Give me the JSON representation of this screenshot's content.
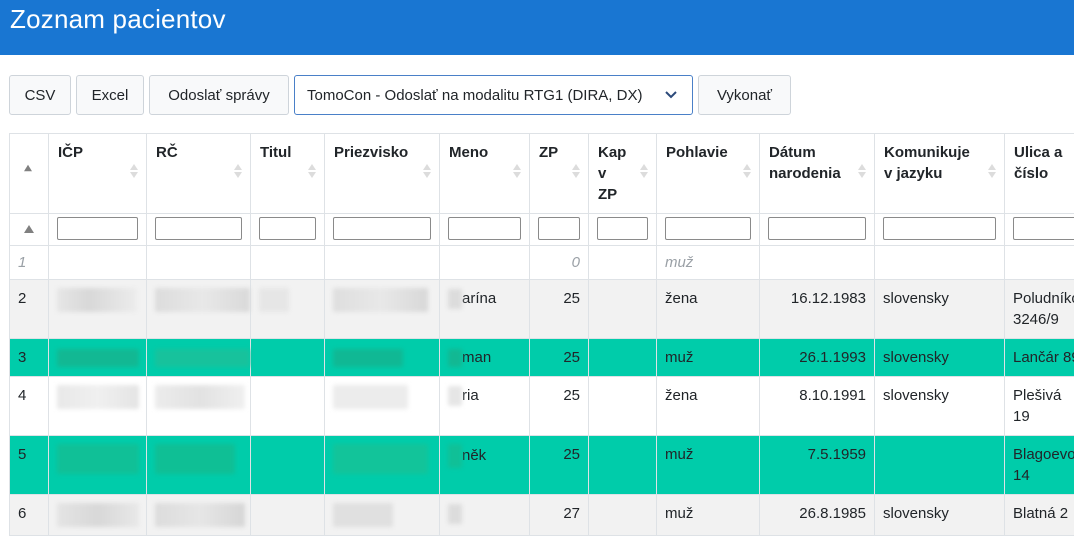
{
  "page": {
    "title": "Zoznam pacientov"
  },
  "toolbar": {
    "csv": "CSV",
    "excel": "Excel",
    "send_messages": "Odoslať správy",
    "action_select": "TomoCon - Odoslať na modalitu RTG1 (DIRA, DX)",
    "execute": "Vykonať"
  },
  "table": {
    "columns": [
      "IČP",
      "RČ",
      "Titul",
      "Priezvisko",
      "Meno",
      "ZP",
      "Kap\nv\nZP",
      "Pohlavie",
      "Dátum\nnarodenia",
      "Komunikuje\nv jazyku",
      "Ulica a\nčíslo"
    ],
    "rows": [
      {
        "n": "1",
        "meno": "",
        "zp": "0",
        "kap": "",
        "pohlavie": "muž",
        "datum": "",
        "jazyk": "",
        "ulica": ""
      },
      {
        "n": "2",
        "meno": "arína",
        "zp": "25",
        "kap": "",
        "pohlavie": "žena",
        "datum": "16.12.1983",
        "jazyk": "slovensky",
        "ulica": "Poludníko\n3246/9"
      },
      {
        "n": "3",
        "meno": "man",
        "zp": "25",
        "kap": "",
        "pohlavie": "muž",
        "datum": "26.1.1993",
        "jazyk": "slovensky",
        "ulica": "Lančár 89"
      },
      {
        "n": "4",
        "meno": "ria",
        "zp": "25",
        "kap": "",
        "pohlavie": "žena",
        "datum": "8.10.1991",
        "jazyk": "slovensky",
        "ulica": "Plešivá 19"
      },
      {
        "n": "5",
        "meno": "něk",
        "zp": "25",
        "kap": "",
        "pohlavie": "muž",
        "datum": "7.5.1959",
        "jazyk": "",
        "ulica": "Blagoevo\n14"
      },
      {
        "n": "6",
        "meno": "",
        "zp": "27",
        "kap": "",
        "pohlavie": "muž",
        "datum": "26.8.1985",
        "jazyk": "slovensky",
        "ulica": "Blatná 2"
      }
    ]
  },
  "colors": {
    "header": "#1976d2",
    "highlight": "#00ccaa"
  },
  "icons": {
    "sort": "sort-icon",
    "select": "chevron-down-icon"
  }
}
